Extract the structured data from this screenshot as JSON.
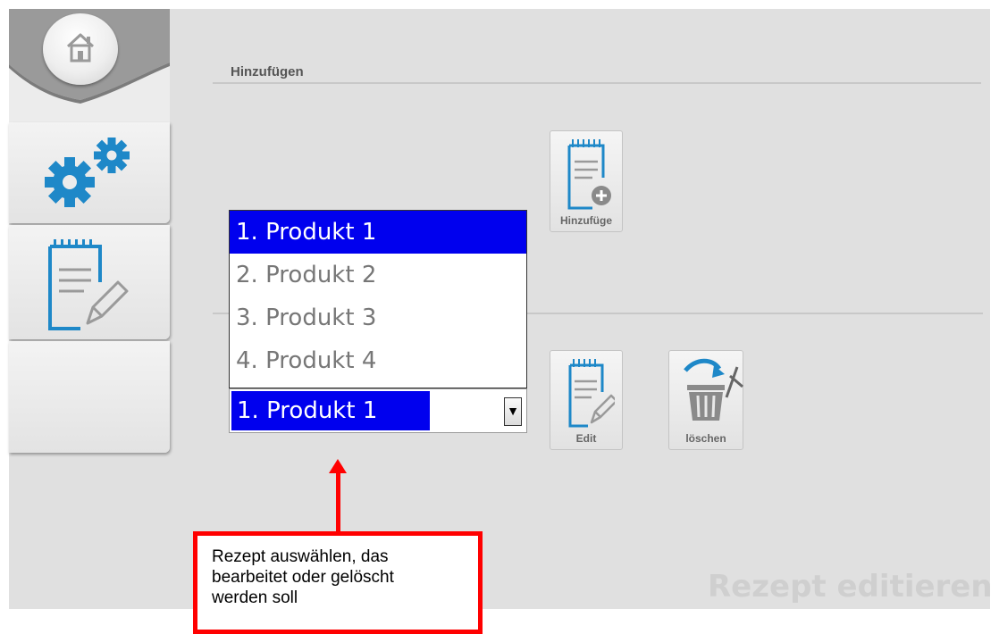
{
  "sidebar": {
    "tabs": [
      {
        "icon": "home-icon"
      },
      {
        "icon": "gears-icon"
      },
      {
        "icon": "recipe-edit-icon"
      },
      {
        "icon": ""
      }
    ]
  },
  "add_section": {
    "title": "Hinzufügen",
    "add_button_label": "Hinzufüge"
  },
  "recipe_list": {
    "items": [
      "1. Produkt 1",
      "2. Produkt 2",
      "3. Produkt 3",
      "4. Produkt 4"
    ],
    "selected_index": 0
  },
  "combo": {
    "value": "1. Produkt 1",
    "arrow": "▼"
  },
  "actions": {
    "edit_label": "Edit",
    "delete_label": "löschen"
  },
  "watermark": "Rezept editieren",
  "callout": {
    "line1": "Rezept auswählen, das",
    "line2": "bearbeitet oder gelöscht",
    "line3": "werden soll"
  },
  "colors": {
    "selection": "#0000ee",
    "icon_blue": "#1e88c8",
    "callout_red": "#ff0000",
    "panel_bg": "#e0e0e0"
  }
}
